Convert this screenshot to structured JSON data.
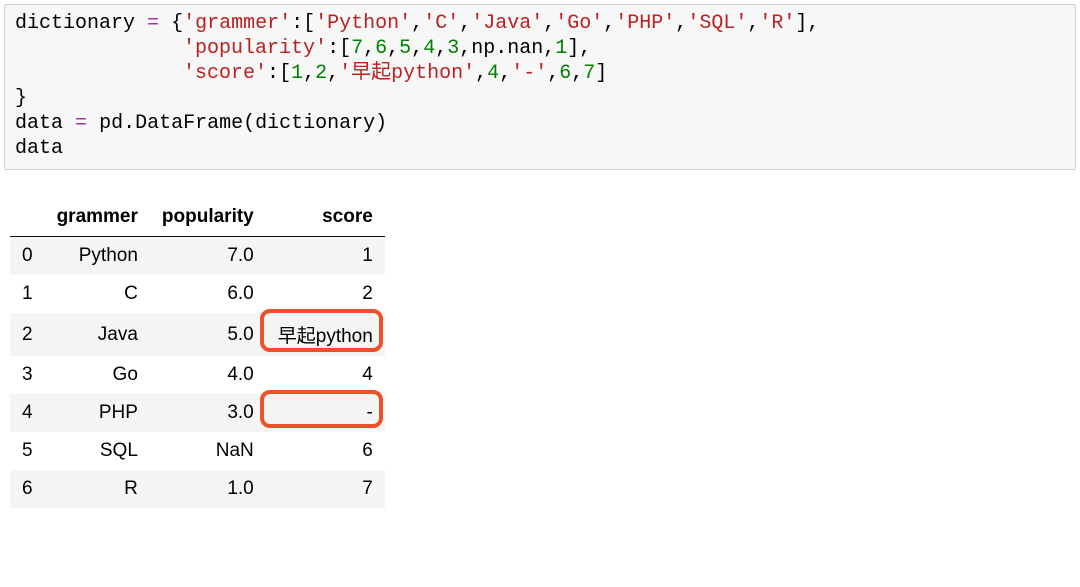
{
  "code": {
    "tokens": [
      {
        "row": 0,
        "col": 0,
        "t": "dictionary",
        "cls": "c-var"
      },
      {
        "row": 0,
        "col": 11,
        "t": "=",
        "cls": "c-op"
      },
      {
        "row": 0,
        "col": 13,
        "t": "{",
        "cls": "c-var"
      },
      {
        "row": 0,
        "col": 14,
        "t": "'grammer'",
        "cls": "c-str"
      },
      {
        "row": 0,
        "col": 23,
        "t": ":",
        "cls": "c-var"
      },
      {
        "row": 0,
        "col": 24,
        "t": "[",
        "cls": "c-var"
      },
      {
        "row": 0,
        "col": 25,
        "t": "'Python'",
        "cls": "c-str"
      },
      {
        "row": 0,
        "col": 33,
        "t": ",",
        "cls": "c-var"
      },
      {
        "row": 0,
        "col": 34,
        "t": "'C'",
        "cls": "c-str"
      },
      {
        "row": 0,
        "col": 37,
        "t": ",",
        "cls": "c-var"
      },
      {
        "row": 0,
        "col": 38,
        "t": "'Java'",
        "cls": "c-str"
      },
      {
        "row": 0,
        "col": 44,
        "t": ",",
        "cls": "c-var"
      },
      {
        "row": 0,
        "col": 45,
        "t": "'Go'",
        "cls": "c-str"
      },
      {
        "row": 0,
        "col": 49,
        "t": ",",
        "cls": "c-var"
      },
      {
        "row": 0,
        "col": 50,
        "t": "'PHP'",
        "cls": "c-str"
      },
      {
        "row": 0,
        "col": 55,
        "t": ",",
        "cls": "c-var"
      },
      {
        "row": 0,
        "col": 56,
        "t": "'SQL'",
        "cls": "c-str"
      },
      {
        "row": 0,
        "col": 61,
        "t": ",",
        "cls": "c-var"
      },
      {
        "row": 0,
        "col": 62,
        "t": "'R'",
        "cls": "c-str"
      },
      {
        "row": 0,
        "col": 65,
        "t": "],",
        "cls": "c-var"
      },
      {
        "row": 1,
        "col": 14,
        "t": "'popularity'",
        "cls": "c-str"
      },
      {
        "row": 1,
        "col": 26,
        "t": ":",
        "cls": "c-var"
      },
      {
        "row": 1,
        "col": 27,
        "t": "[",
        "cls": "c-var"
      },
      {
        "row": 1,
        "col": 28,
        "t": "7",
        "cls": "c-num"
      },
      {
        "row": 1,
        "col": 29,
        "t": ",",
        "cls": "c-var"
      },
      {
        "row": 1,
        "col": 30,
        "t": "6",
        "cls": "c-num"
      },
      {
        "row": 1,
        "col": 31,
        "t": ",",
        "cls": "c-var"
      },
      {
        "row": 1,
        "col": 32,
        "t": "5",
        "cls": "c-num"
      },
      {
        "row": 1,
        "col": 33,
        "t": ",",
        "cls": "c-var"
      },
      {
        "row": 1,
        "col": 34,
        "t": "4",
        "cls": "c-num"
      },
      {
        "row": 1,
        "col": 35,
        "t": ",",
        "cls": "c-var"
      },
      {
        "row": 1,
        "col": 36,
        "t": "3",
        "cls": "c-num"
      },
      {
        "row": 1,
        "col": 37,
        "t": ",",
        "cls": "c-var"
      },
      {
        "row": 1,
        "col": 38,
        "t": "np.nan",
        "cls": "c-nan"
      },
      {
        "row": 1,
        "col": 44,
        "t": ",",
        "cls": "c-var"
      },
      {
        "row": 1,
        "col": 45,
        "t": "1",
        "cls": "c-num"
      },
      {
        "row": 1,
        "col": 46,
        "t": "],",
        "cls": "c-var"
      },
      {
        "row": 2,
        "col": 14,
        "t": "'score'",
        "cls": "c-str"
      },
      {
        "row": 2,
        "col": 21,
        "t": ":",
        "cls": "c-var"
      },
      {
        "row": 2,
        "col": 22,
        "t": "[",
        "cls": "c-var"
      },
      {
        "row": 2,
        "col": 23,
        "t": "1",
        "cls": "c-num"
      },
      {
        "row": 2,
        "col": 24,
        "t": ",",
        "cls": "c-var"
      },
      {
        "row": 2,
        "col": 25,
        "t": "2",
        "cls": "c-num"
      },
      {
        "row": 2,
        "col": 26,
        "t": ",",
        "cls": "c-var"
      },
      {
        "row": 2,
        "col": 27,
        "t": "'早起python'",
        "cls": "c-str"
      },
      {
        "row": 2,
        "col": 37,
        "t": ",",
        "cls": "c-var"
      },
      {
        "row": 2,
        "col": 38,
        "t": "4",
        "cls": "c-num"
      },
      {
        "row": 2,
        "col": 39,
        "t": ",",
        "cls": "c-var"
      },
      {
        "row": 2,
        "col": 40,
        "t": "'-'",
        "cls": "c-str"
      },
      {
        "row": 2,
        "col": 43,
        "t": ",",
        "cls": "c-var"
      },
      {
        "row": 2,
        "col": 44,
        "t": "6",
        "cls": "c-num"
      },
      {
        "row": 2,
        "col": 45,
        "t": ",",
        "cls": "c-var"
      },
      {
        "row": 2,
        "col": 46,
        "t": "7",
        "cls": "c-num"
      },
      {
        "row": 2,
        "col": 47,
        "t": "]",
        "cls": "c-var"
      },
      {
        "row": 3,
        "col": 0,
        "t": "}",
        "cls": "c-var"
      },
      {
        "row": 4,
        "col": 0,
        "t": "data",
        "cls": "c-var"
      },
      {
        "row": 4,
        "col": 5,
        "t": "=",
        "cls": "c-op"
      },
      {
        "row": 4,
        "col": 7,
        "t": "pd.DataFrame(dictionary)",
        "cls": "c-var"
      },
      {
        "row": 5,
        "col": 0,
        "t": "data",
        "cls": "c-var"
      }
    ],
    "rows": 6
  },
  "table": {
    "columns": [
      "grammer",
      "popularity",
      "score"
    ],
    "index": [
      "0",
      "1",
      "2",
      "3",
      "4",
      "5",
      "6"
    ],
    "data": [
      [
        "Python",
        "7.0",
        "1"
      ],
      [
        "C",
        "6.0",
        "2"
      ],
      [
        "Java",
        "5.0",
        "早起python"
      ],
      [
        "Go",
        "4.0",
        "4"
      ],
      [
        "PHP",
        "3.0",
        "-"
      ],
      [
        "SQL",
        "NaN",
        "6"
      ],
      [
        "R",
        "1.0",
        "7"
      ]
    ]
  },
  "annotations": [
    {
      "target": "cell-2-score"
    },
    {
      "target": "cell-4-score"
    }
  ]
}
